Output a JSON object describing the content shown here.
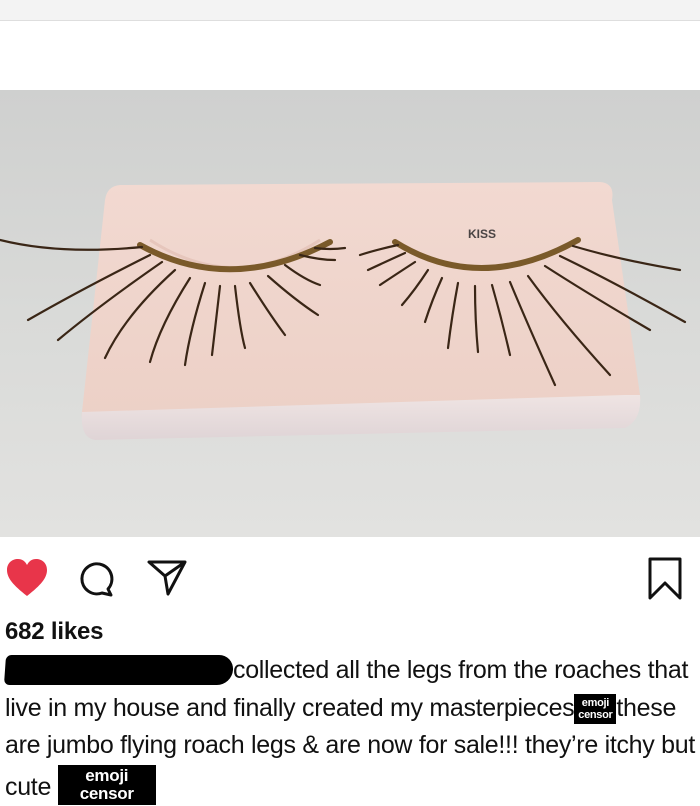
{
  "post": {
    "image_brand": "KISS",
    "likes": "682 likes",
    "caption": {
      "part1": "collected all the legs from the roaches that live in my house and finally created my masterpieces",
      "part2": "these are jumbo flying roach legs & are now for sale!!! they’re itchy but cute"
    },
    "censor_label_line1": "emoji",
    "censor_label_line2": "censor"
  },
  "colors": {
    "heart": "#e8354a",
    "icon_stroke": "#111111"
  },
  "icons": [
    "heart-icon",
    "comment-icon",
    "share-icon",
    "bookmark-icon"
  ]
}
